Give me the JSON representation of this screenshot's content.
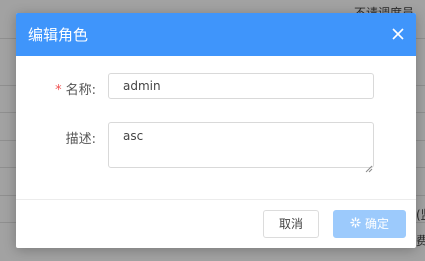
{
  "background": {
    "row_texts": [
      "不请调度员",
      "(监",
      "费"
    ]
  },
  "dialog": {
    "title": "编辑角色",
    "close_icon": "close-icon",
    "name_field": {
      "required_mark": "*",
      "label": "名称:",
      "value": "admin"
    },
    "description_field": {
      "label": "描述:",
      "value": "asc"
    },
    "buttons": {
      "cancel_label": "取消",
      "confirm_label": "确定",
      "confirm_icon": "loading-spinner-icon",
      "confirm_state": "loading"
    }
  },
  "colors": {
    "header": "#3f95fb",
    "confirm_button": "#9ccafc",
    "required_mark": "#f05050"
  }
}
